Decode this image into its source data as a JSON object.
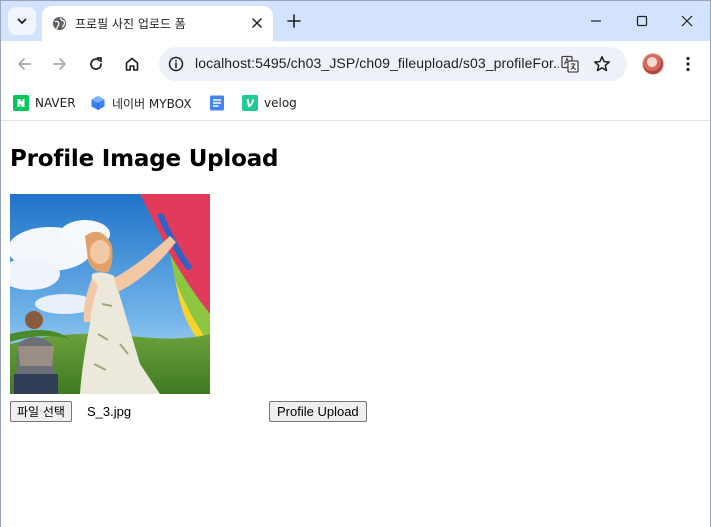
{
  "browser": {
    "tab": {
      "title": "프로필 사진 업로드 폼",
      "favicon_icon": "globe-icon"
    },
    "address_bar": {
      "url": "localhost:5495/ch03_JSP/ch09_fileupload/s03_profileFor..."
    },
    "bookmarks": [
      {
        "label": "NAVER",
        "icon": "naver-icon",
        "color": "#03c75a"
      },
      {
        "label": "네이버 MYBOX",
        "icon": "mybox-icon",
        "color": "#3b82f6"
      },
      {
        "label": "",
        "icon": "docs-icon",
        "color": "#4285f4"
      },
      {
        "label": "velog",
        "icon": "velog-icon",
        "color": "#20c997"
      }
    ]
  },
  "page": {
    "title": "Profile Image Upload",
    "file_button_label": "파일 선택",
    "selected_file": "S_3.jpg",
    "upload_button_label": "Profile Upload"
  }
}
